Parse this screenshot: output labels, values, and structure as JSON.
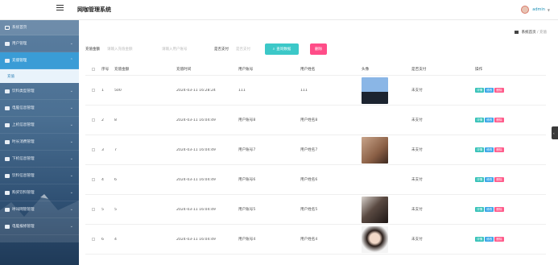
{
  "app": {
    "title": "网咖管理系统",
    "user": "admin"
  },
  "sidebar": {
    "items": [
      {
        "label": "系统首页"
      },
      {
        "label": "用户管理"
      },
      {
        "label": "充值管理"
      },
      {
        "label": "充值"
      },
      {
        "label": "饮料类型管理"
      },
      {
        "label": "电脑信息管理"
      },
      {
        "label": "上机信息管理"
      },
      {
        "label": "时长消费管理"
      },
      {
        "label": "下机信息管理"
      },
      {
        "label": "饮料信息管理"
      },
      {
        "label": "购买饮料管理"
      },
      {
        "label": "呼叫网管管理"
      },
      {
        "label": "电脑报修管理"
      }
    ]
  },
  "breadcrumb": {
    "home": "系统首页",
    "sep": "/",
    "current": "充值"
  },
  "search": {
    "amount_label": "充值金额",
    "amount_placeholder": "请输入充值金额",
    "account_label": "",
    "account_placeholder": "请输入用户账号",
    "pay_label": "是否支付",
    "pay_placeholder": "是否支付",
    "search_btn": "查询数据",
    "delete_btn": "删除"
  },
  "table": {
    "headers": [
      "序号",
      "充值金额",
      "充值时间",
      "用户账号",
      "用户姓名",
      "头像",
      "是否支付",
      "操作"
    ],
    "rows": [
      {
        "no": "1",
        "amount": "500",
        "time": "2024-03-11 16:28:24",
        "account": "111",
        "name": "111",
        "avatar": "man-suit",
        "pay": "未支付"
      },
      {
        "no": "2",
        "amount": "8",
        "time": "2024-03-11 16:04:49",
        "account": "用户账号8",
        "name": "用户姓名8",
        "avatar": "none",
        "pay": "未支付"
      },
      {
        "no": "3",
        "amount": "7",
        "time": "2024-03-11 16:04:49",
        "account": "用户账号7",
        "name": "用户姓名7",
        "avatar": "photo-brown",
        "pay": "未支付"
      },
      {
        "no": "4",
        "amount": "6",
        "time": "2024-03-11 16:04:49",
        "account": "用户账号6",
        "name": "用户姓名6",
        "avatar": "none",
        "pay": "未支付"
      },
      {
        "no": "5",
        "amount": "5",
        "time": "2024-03-11 16:04:49",
        "account": "用户账号5",
        "name": "用户姓名5",
        "avatar": "photo-dark",
        "pay": "未支付"
      },
      {
        "no": "6",
        "amount": "4",
        "time": "2024-03-11 16:04:49",
        "account": "用户账号4",
        "name": "用户姓名4",
        "avatar": "woman",
        "pay": "未支付"
      }
    ],
    "actions": {
      "detail": "详情",
      "edit": "修改",
      "delete": "删除"
    }
  },
  "colors": {
    "accent": "#3cc8c8",
    "danger": "#ff4d88",
    "active_menu": "#3a9cd6"
  }
}
